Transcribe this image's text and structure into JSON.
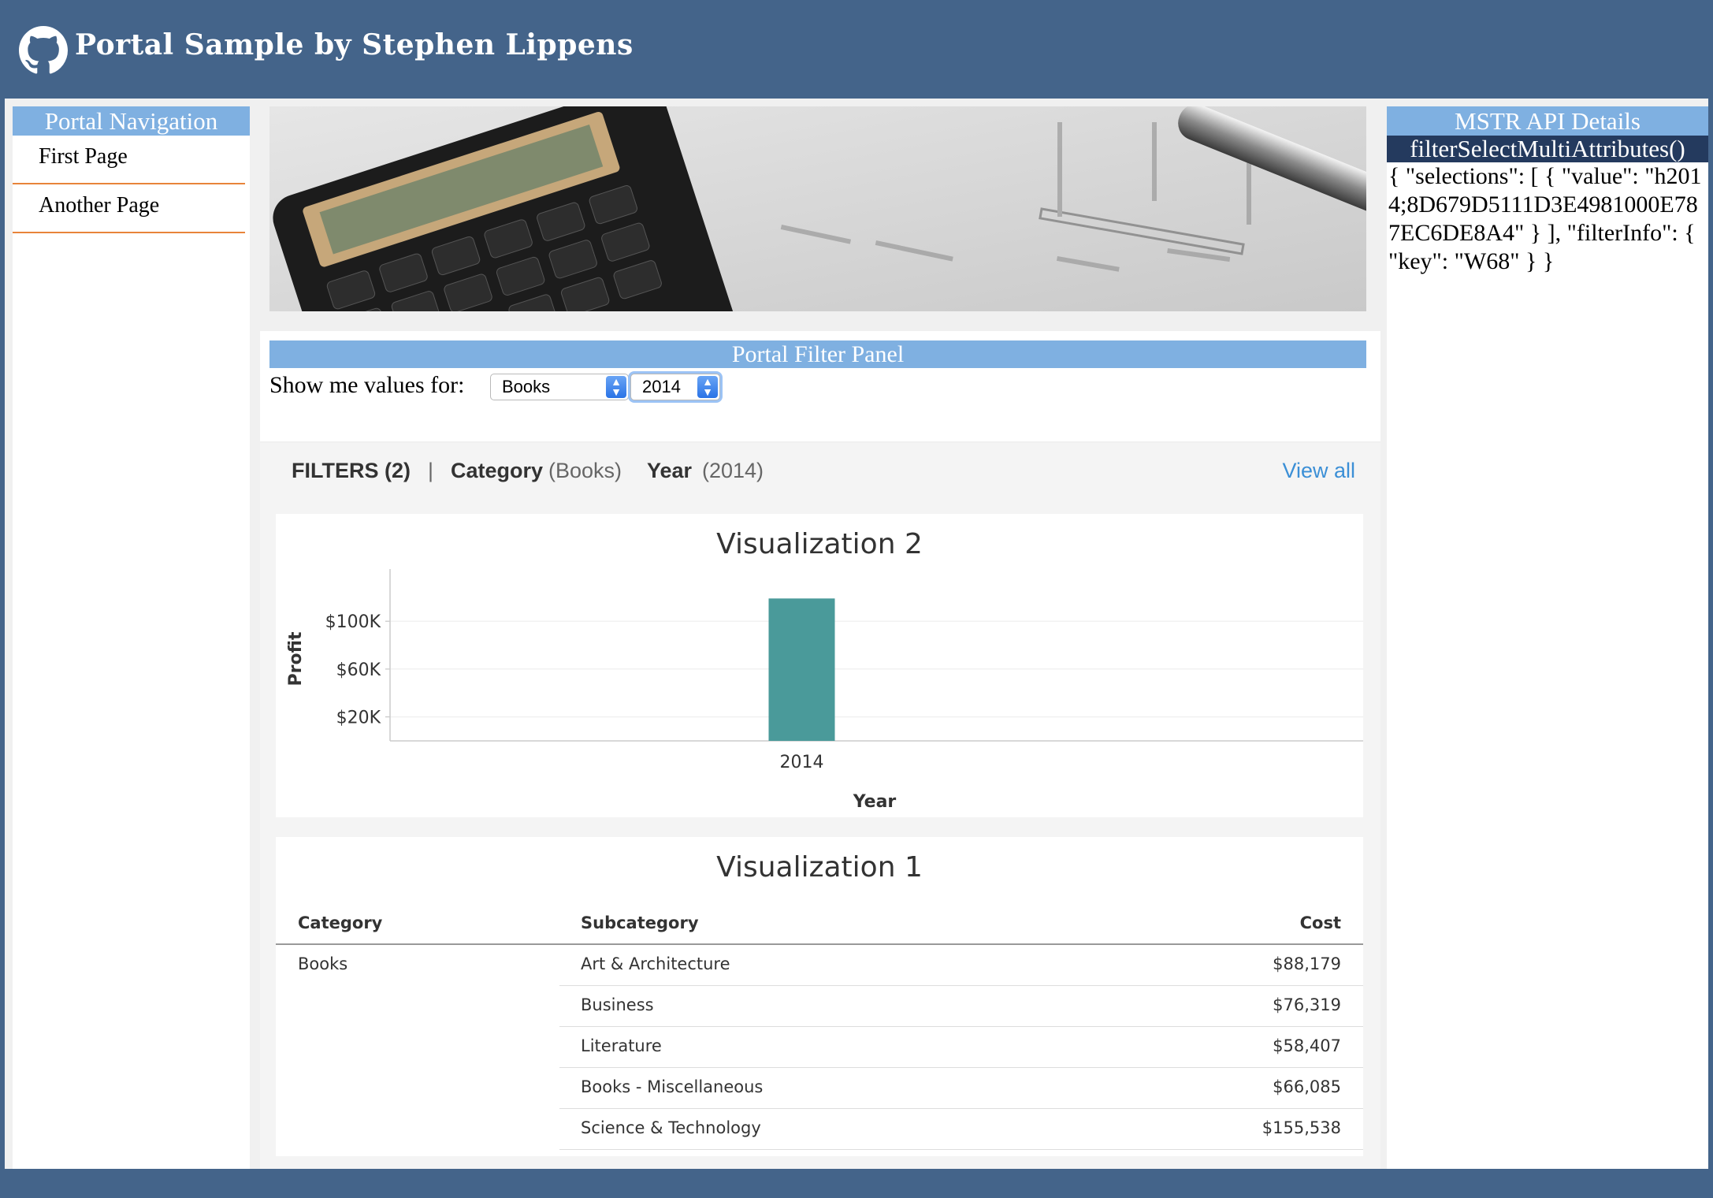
{
  "header": {
    "title": "Portal Sample by Stephen Lippens",
    "logo_icon": "github-icon"
  },
  "nav": {
    "title": "Portal Navigation",
    "items": [
      {
        "label": "First Page"
      },
      {
        "label": "Another Page"
      }
    ]
  },
  "filter_panel": {
    "title": "Portal Filter Panel",
    "label": "Show me values for:",
    "category_select": "Books",
    "year_select": "2014"
  },
  "filters_bar": {
    "label": "FILTERS (2)",
    "separator": "|",
    "f1_name": "Category",
    "f1_value": "(Books)",
    "f2_name": "Year",
    "f2_value": "(2014)",
    "view_all": "View all"
  },
  "viz2": {
    "title": "Visualization 2",
    "chart_data": {
      "type": "bar",
      "categories": [
        "2014"
      ],
      "values": [
        119000
      ],
      "xlabel": "Year",
      "ylabel": "Profit",
      "yticks": [
        20000,
        60000,
        100000
      ],
      "ytick_labels": [
        "$20K",
        "$60K",
        "$100K"
      ],
      "ylim": [
        0,
        137000
      ],
      "color": "#4a9a9a"
    }
  },
  "viz1": {
    "title": "Visualization 1",
    "chart_data": {
      "type": "table",
      "columns": [
        "Category",
        "Subcategory",
        "Cost"
      ],
      "rows": [
        [
          "Books",
          "Art & Architecture",
          "$88,179"
        ],
        [
          "",
          "Business",
          "$76,319"
        ],
        [
          "",
          "Literature",
          "$58,407"
        ],
        [
          "",
          "Books - Miscellaneous",
          "$66,085"
        ],
        [
          "",
          "Science & Technology",
          "$155,538"
        ]
      ]
    }
  },
  "api": {
    "title": "MSTR API Details",
    "method": "filterSelectMultiAttributes()",
    "json": "{ \"selections\": [ { \"value\": \"h2014;8D679D5111D3E4981000E787EC6DE8A4\" } ], \"filterInfo\": { \"key\": \"W68\" } }"
  },
  "colors": {
    "header_bg": "#44648a",
    "panel_head": "#7fb0e1",
    "nav_divider": "#e8843a",
    "bar": "#4a9a9a",
    "link": "#3b8fd6"
  }
}
